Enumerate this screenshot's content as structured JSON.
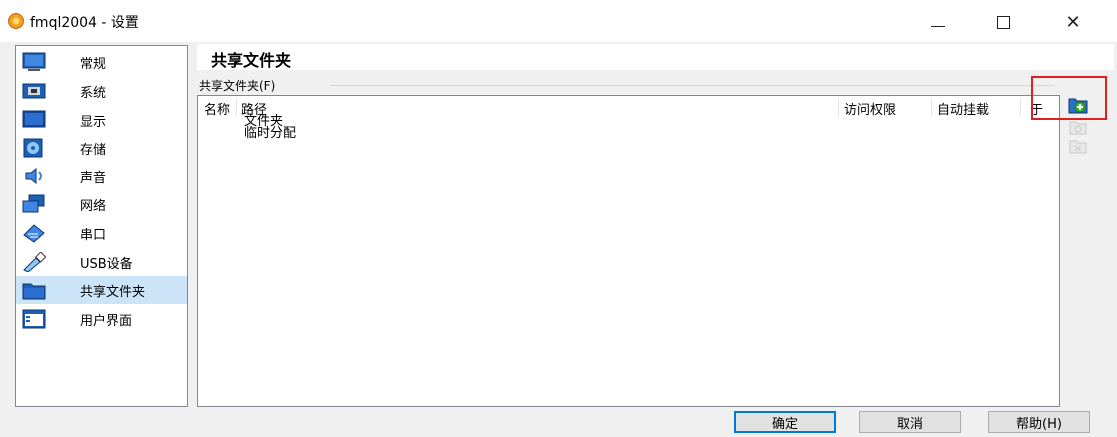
{
  "window": {
    "title": "fmql2004 - 设置",
    "app_icon": "virtualbox-icon"
  },
  "sidebar": {
    "items": [
      {
        "label": "常规",
        "icon": "general-icon"
      },
      {
        "label": "系统",
        "icon": "system-icon"
      },
      {
        "label": "显示",
        "icon": "display-icon"
      },
      {
        "label": "存储",
        "icon": "storage-icon"
      },
      {
        "label": "声音",
        "icon": "audio-icon"
      },
      {
        "label": "网络",
        "icon": "network-icon"
      },
      {
        "label": "串口",
        "icon": "serial-port-icon"
      },
      {
        "label": "USB设备",
        "icon": "usb-icon"
      },
      {
        "label": "共享文件夹",
        "icon": "shared-folder-icon"
      },
      {
        "label": "用户界面",
        "icon": "user-interface-icon"
      }
    ],
    "selected": "共享文件夹"
  },
  "main": {
    "title": "共享文件夹",
    "group_label": "共享文件夹(F)",
    "columns": [
      "名称",
      "路径",
      "访问权限",
      "自动挂载",
      "于"
    ],
    "tree": [
      "文件夹",
      "临时分配"
    ]
  },
  "toolbar": {
    "add_icon": "add-shared-folder-icon",
    "edit_icon": "edit-shared-folder-icon",
    "remove_icon": "remove-shared-folder-icon"
  },
  "buttons": {
    "ok": "确定",
    "cancel": "取消",
    "help": "帮助(H)"
  },
  "colors": {
    "selection": "#cce4f7",
    "highlight": "#e02020",
    "default_button_border": "#0078d7"
  }
}
